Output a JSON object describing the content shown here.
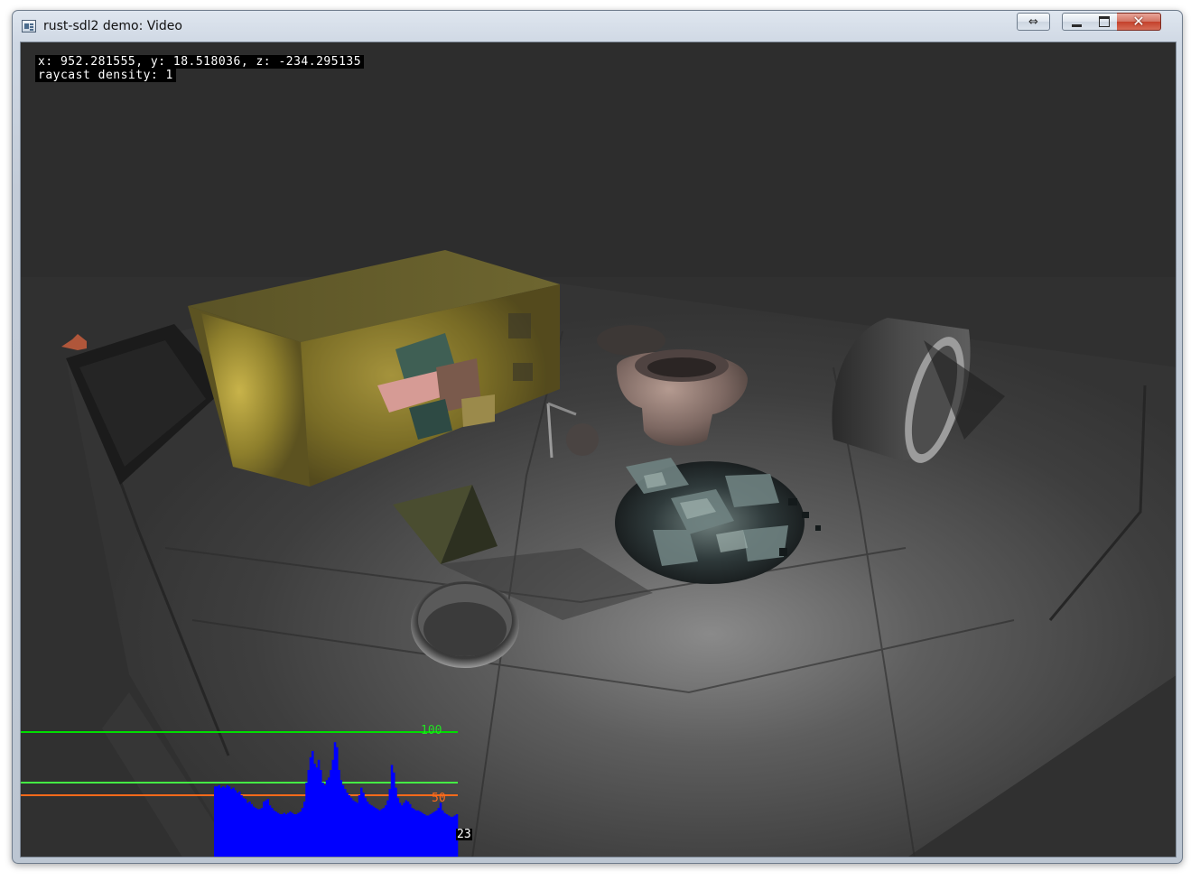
{
  "window": {
    "title": "rust-sdl2 demo: Video",
    "controls": {
      "restore_arrow": "⇔",
      "minimize": "minimize",
      "maximize": "maximize",
      "close": "✕"
    }
  },
  "hud": {
    "position_line": "x: 952.281555, y: 18.518036, z: -234.295135",
    "density_line": "raycast density: 1"
  },
  "frame_graph": {
    "label_100": "100",
    "label_50": "50",
    "current_value": "23",
    "colors": {
      "bars": "#0000ff",
      "line_100": "#00dd00",
      "line_60": "#44ee44",
      "line_50": "#ff6a1a"
    },
    "scale_max": 100,
    "lines": [
      100,
      60,
      50
    ],
    "samples": [
      57,
      57,
      58,
      56,
      57,
      56,
      58,
      57,
      55,
      56,
      54,
      52,
      53,
      50,
      48,
      47,
      44,
      45,
      43,
      41,
      40,
      39,
      39,
      40,
      45,
      46,
      47,
      42,
      40,
      38,
      37,
      36,
      35,
      35,
      36,
      35,
      36,
      37,
      36,
      35,
      35,
      36,
      37,
      40,
      45,
      60,
      70,
      80,
      85,
      75,
      72,
      78,
      70,
      60,
      58,
      62,
      64,
      70,
      78,
      92,
      88,
      70,
      62,
      58,
      55,
      52,
      50,
      48,
      46,
      45,
      44,
      50,
      56,
      52,
      48,
      45,
      43,
      42,
      41,
      40,
      39,
      38,
      39,
      40,
      42,
      46,
      55,
      74,
      68,
      56,
      48,
      44,
      42,
      44,
      46,
      45,
      43,
      40,
      39,
      38,
      38,
      37,
      36,
      35,
      34,
      34,
      35,
      36,
      37,
      38,
      40,
      44,
      38,
      36,
      35,
      34,
      33,
      33,
      34,
      35
    ]
  }
}
